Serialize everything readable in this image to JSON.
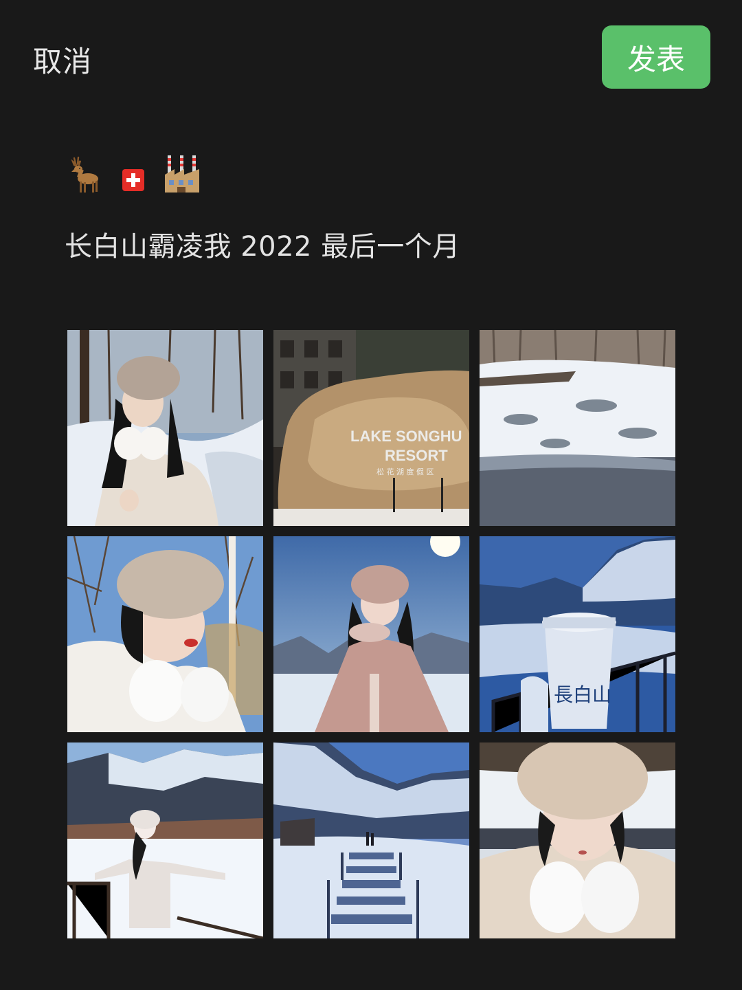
{
  "header": {
    "cancel_label": "取消",
    "publish_label": "发表"
  },
  "colors": {
    "background": "#191919",
    "publish_button": "#5ac06a",
    "text": "#e3e3e3"
  },
  "post": {
    "emojis": [
      "deer-emoji",
      "swiss-flag-emoji",
      "factory-emoji"
    ],
    "text": "长白山霸凌我 2022 最后一个月"
  },
  "photos": [
    {
      "name": "photo-girl-fur-hat-forest",
      "sign": {
        "line1": "",
        "line2": "",
        "line3": ""
      }
    },
    {
      "name": "photo-resort-rock-sign",
      "sign": {
        "line1": "LAKE SONGHU",
        "line2": "RESORT",
        "line3": "松 花 湖 度 假 区"
      }
    },
    {
      "name": "photo-snowy-river",
      "sign": {
        "line1": "",
        "line2": "",
        "line3": ""
      }
    },
    {
      "name": "photo-girl-selfie-birch",
      "sign": {
        "line1": "",
        "line2": "",
        "line3": ""
      }
    },
    {
      "name": "photo-girl-mountain-sun",
      "sign": {
        "line1": "",
        "line2": "",
        "line3": ""
      }
    },
    {
      "name": "photo-coffee-cup-mountains",
      "sign": {
        "line1": "長白山",
        "line2": "",
        "line3": ""
      }
    },
    {
      "name": "photo-girl-arms-open-snow",
      "sign": {
        "line1": "",
        "line2": "",
        "line3": ""
      }
    },
    {
      "name": "photo-snowy-stairs-valley",
      "sign": {
        "line1": "",
        "line2": "",
        "line3": ""
      }
    },
    {
      "name": "photo-girl-closeup-earmuffs",
      "sign": {
        "line1": "",
        "line2": "",
        "line3": ""
      }
    }
  ]
}
